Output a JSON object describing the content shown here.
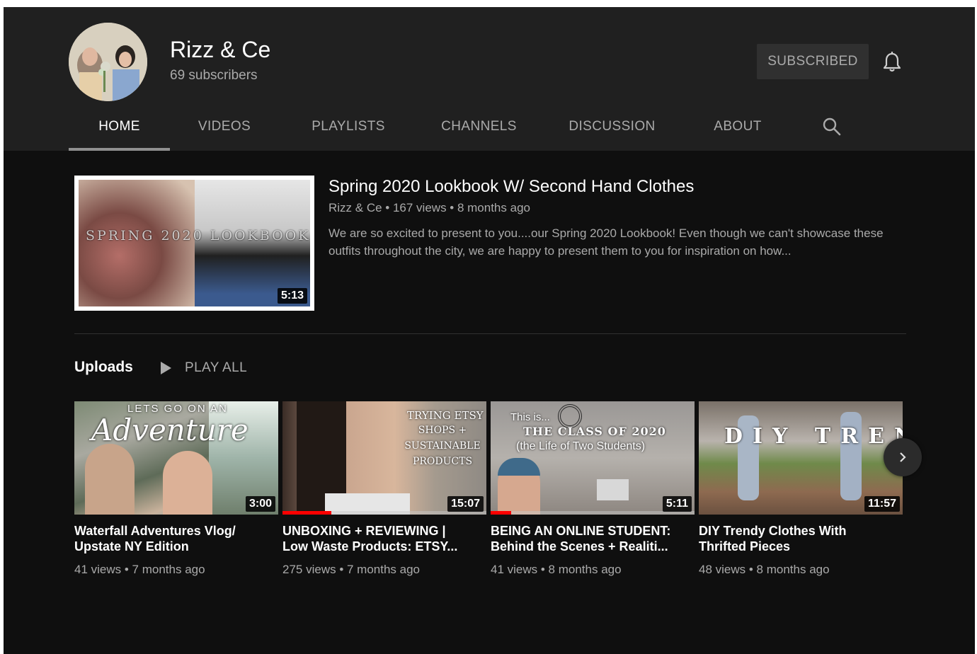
{
  "channel": {
    "name": "Rizz & Ce",
    "subscribers": "69 subscribers",
    "subscribe_label": "SUBSCRIBED"
  },
  "tabs": [
    {
      "label": "HOME",
      "active": true
    },
    {
      "label": "VIDEOS",
      "active": false
    },
    {
      "label": "PLAYLISTS",
      "active": false
    },
    {
      "label": "CHANNELS",
      "active": false
    },
    {
      "label": "DISCUSSION",
      "active": false
    },
    {
      "label": "ABOUT",
      "active": false
    }
  ],
  "featured": {
    "thumb_text": "SPRING 2020 LOOKBOOK",
    "duration": "5:13",
    "title": "Spring 2020 Lookbook W/ Second Hand Clothes",
    "meta": "Rizz & Ce • 167 views • 8 months ago",
    "description": "We are so excited to present to you....our Spring 2020 Lookbook! Even though we can't showcase these outfits throughout the city, we are happy to present them to you for inspiration on how..."
  },
  "uploads": {
    "label": "Uploads",
    "play_all": "PLAY ALL",
    "videos": [
      {
        "thumb_line1": "LETS GO ON AN",
        "thumb_line2": "Adventure",
        "duration": "3:00",
        "title_line1": "Waterfall Adventures Vlog/",
        "title_line2": "Upstate NY Edition",
        "meta": "41 views • 7 months ago",
        "progress": 0
      },
      {
        "thumb_line1": "TRYING ETSY",
        "thumb_line2": "SHOPS +",
        "thumb_line3": "SUSTAINABLE",
        "thumb_line4": "PRODUCTS",
        "duration": "15:07",
        "title_line1": "UNBOXING + REVIEWING |",
        "title_line2": "Low Waste Products: ETSY...",
        "meta": "275 views • 7 months ago",
        "progress": 0.24
      },
      {
        "thumb_line1": "This is...",
        "thumb_line2": "THE CLASS OF 2020",
        "thumb_line3": "(the Life of Two Students)",
        "duration": "5:11",
        "title_line1": "BEING AN ONLINE STUDENT:",
        "title_line2": "Behind the Scenes + Realiti...",
        "meta": "41 views • 8 months ago",
        "progress": 0.1
      },
      {
        "thumb_line1": "DIY TRENDS",
        "duration": "11:57",
        "title_line1": "DIY Trendy Clothes With",
        "title_line2": "Thrifted Pieces",
        "meta": "48 views • 8 months ago",
        "progress": 0
      }
    ]
  },
  "colors": {
    "background": "#0f0f0f",
    "header": "#202020",
    "progress": "#ff0000"
  }
}
